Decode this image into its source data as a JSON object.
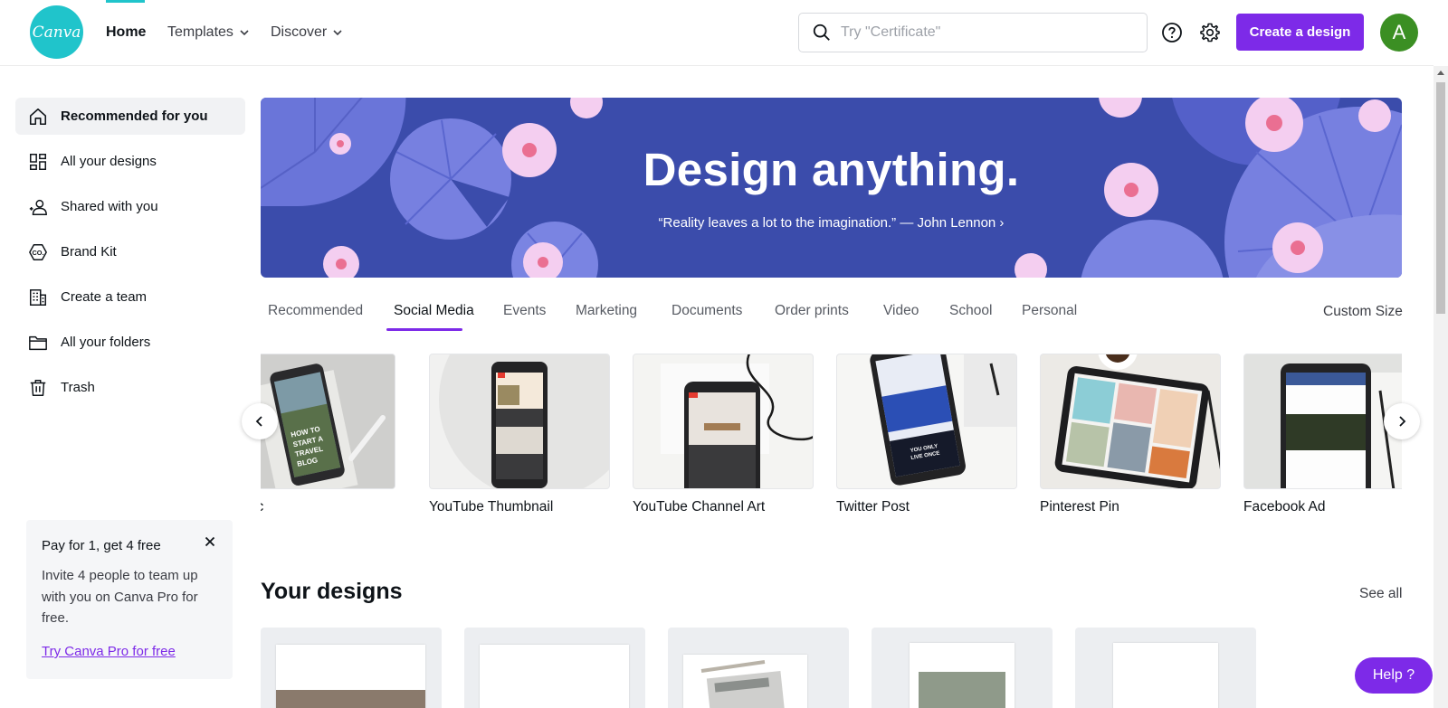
{
  "header": {
    "logo_text": "Canva",
    "nav": {
      "home": "Home",
      "templates": "Templates",
      "discover": "Discover"
    },
    "search_placeholder": "Try \"Certificate\"",
    "create_button": "Create a design",
    "avatar_initial": "A",
    "brand_color": "#7d2ae8",
    "logo_color": "#20c4cb"
  },
  "sidebar": {
    "items": [
      {
        "label": "Recommended for you",
        "icon": "home-icon",
        "active": true
      },
      {
        "label": "All your designs",
        "icon": "grid-icon"
      },
      {
        "label": "Shared with you",
        "icon": "people-icon"
      },
      {
        "label": "Brand Kit",
        "icon": "brand-kit-icon"
      },
      {
        "label": "Create a team",
        "icon": "building-icon"
      },
      {
        "label": "All your folders",
        "icon": "folder-icon"
      },
      {
        "label": "Trash",
        "icon": "trash-icon"
      }
    ],
    "promo": {
      "title": "Pay for 1, get 4 free",
      "body": "Invite 4 people to team up with you on Canva Pro for free.",
      "link": "Try Canva Pro for free"
    }
  },
  "hero": {
    "title": "Design anything.",
    "quote": "“Reality leaves a lot to the imagination.” — John Lennon ›",
    "background_color": "#3b4cab"
  },
  "categories": {
    "tabs": [
      "Recommended",
      "Social Media",
      "Events",
      "Marketing",
      "Documents",
      "Order prints",
      "Video",
      "School",
      "Personal"
    ],
    "active": "Social Media",
    "custom_size": "Custom Size"
  },
  "templates": [
    {
      "label": "Graphic"
    },
    {
      "label": "YouTube Thumbnail"
    },
    {
      "label": "YouTube Channel Art"
    },
    {
      "label": "Twitter Post"
    },
    {
      "label": "Pinterest Pin"
    },
    {
      "label": "Facebook Ad"
    }
  ],
  "thumb_text": {
    "travel_blog": "HOW TO START A TRAVEL BLOG",
    "you_only_live_once": "YOU ONLY LIVE ONCE"
  },
  "your_designs": {
    "title": "Your designs",
    "see_all": "See all"
  },
  "help_button": "Help  ?"
}
